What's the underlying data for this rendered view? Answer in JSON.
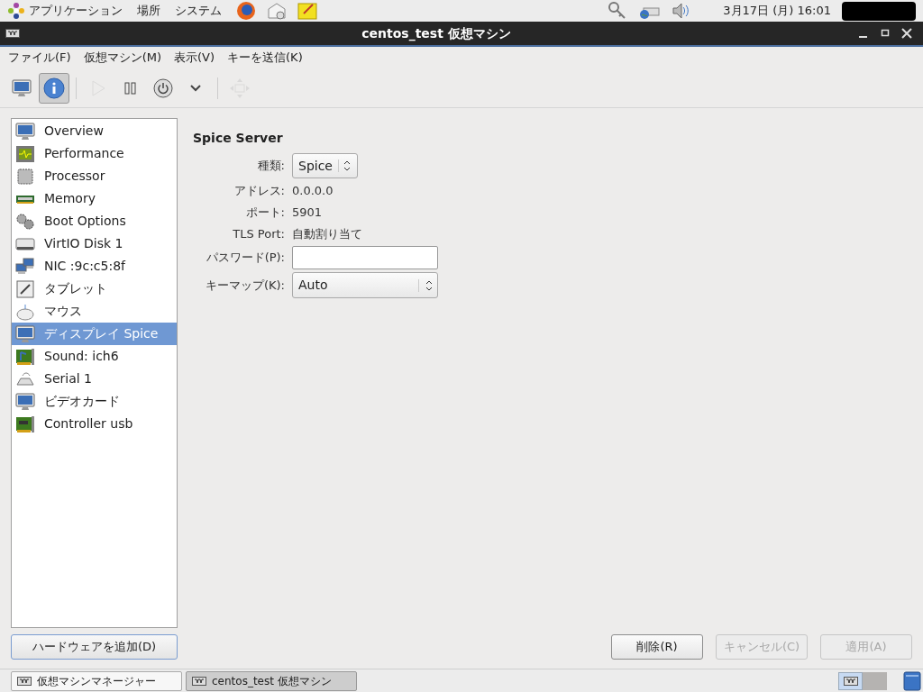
{
  "top_panel": {
    "menus": [
      "アプリケーション",
      "場所",
      "システム"
    ],
    "clock": "3月17日 (月) 16:01"
  },
  "window": {
    "title": "centos_test 仮想マシン"
  },
  "menubar": [
    "ファイル(F)",
    "仮想マシン(M)",
    "表示(V)",
    "キーを送信(K)"
  ],
  "toolbar": [
    {
      "kind": "console",
      "selected": false,
      "disabled": false
    },
    {
      "kind": "details",
      "selected": true,
      "disabled": false
    },
    {
      "kind": "run",
      "selected": false,
      "disabled": true
    },
    {
      "kind": "pause",
      "selected": false,
      "disabled": false
    },
    {
      "kind": "power",
      "selected": false,
      "disabled": false
    },
    {
      "kind": "menu",
      "selected": false,
      "disabled": false
    },
    {
      "kind": "fullscreen",
      "selected": false,
      "disabled": true
    }
  ],
  "sidebar": {
    "items": [
      {
        "label": "Overview",
        "selected": false
      },
      {
        "label": "Performance",
        "selected": false
      },
      {
        "label": "Processor",
        "selected": false
      },
      {
        "label": "Memory",
        "selected": false
      },
      {
        "label": "Boot Options",
        "selected": false
      },
      {
        "label": "VirtIO Disk 1",
        "selected": false
      },
      {
        "label": "NIC :9c:c5:8f",
        "selected": false
      },
      {
        "label": "タブレット",
        "selected": false
      },
      {
        "label": "マウス",
        "selected": false
      },
      {
        "label": "ディスプレイ Spice",
        "selected": true
      },
      {
        "label": "Sound: ich6",
        "selected": false
      },
      {
        "label": "Serial 1",
        "selected": false
      },
      {
        "label": "ビデオカード",
        "selected": false
      },
      {
        "label": "Controller usb",
        "selected": false
      }
    ],
    "add_button": "ハードウェアを追加(D)"
  },
  "details": {
    "heading": "Spice Server",
    "fields": [
      {
        "kind": "select",
        "label": "種類:",
        "value": "Spice"
      },
      {
        "kind": "text",
        "label": "アドレス:",
        "value": "0.0.0.0"
      },
      {
        "kind": "text",
        "label": "ポート:",
        "value": "5901"
      },
      {
        "kind": "text",
        "label": "TLS Port:",
        "value": "自動割り当て"
      },
      {
        "kind": "input",
        "label": "パスワード(P):"
      },
      {
        "kind": "wideselect",
        "label": "キーマップ(K):",
        "value": "Auto"
      }
    ]
  },
  "buttons": [
    {
      "label": "削除(R)",
      "disabled": false
    },
    {
      "label": "キャンセル(C)",
      "disabled": true
    },
    {
      "label": "適用(A)",
      "disabled": true
    }
  ],
  "taskbar": {
    "windows": [
      {
        "label": "仮想マシンマネージャー",
        "selected": false
      },
      {
        "label": "centos_test 仮想マシン",
        "selected": true
      }
    ],
    "workspaces": [
      {
        "selected": true
      },
      {
        "selected": false
      }
    ]
  }
}
